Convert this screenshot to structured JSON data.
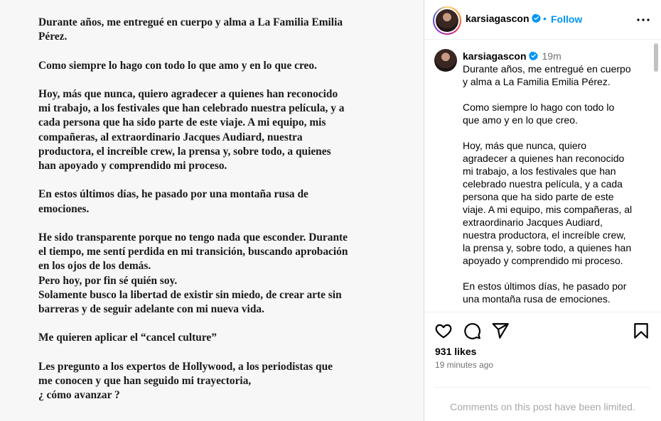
{
  "image_text": {
    "paragraphs": [
      "Durante años, me entregué en cuerpo y alma a La Familia Emilia\nPérez.",
      "Como siempre lo hago con todo lo que amo y en lo que creo.",
      "Hoy, más que nunca, quiero agradecer a quienes han reconocido\nmi trabajo, a los festivales que han celebrado nuestra película, y a\ncada persona que ha sido parte de este viaje. A mi equipo, mis\ncompañeras, al extraordinario Jacques Audiard, nuestra\nproductora, el increíble crew, la prensa y, sobre todo, a quienes\nhan apoyado y comprendido mi proceso.",
      "En estos últimos días, he pasado por una montaña rusa de\nemociones.",
      "He sido transparente porque no tengo nada que esconder. Durante\nel tiempo, me sentí perdida en mi transición, buscando aprobación\nen los ojos de los demás.\nPero hoy, por fin sé quién soy.\nSolamente busco la libertad de existir sin miedo, de crear arte sin\nbarreras y de seguir adelante con mi nueva vida.",
      "Me quieren aplicar el “cancel culture”",
      "Les pregunto a los expertos de Hollywood, a los periodistas que\nme conocen y que han seguido mi trayectoria,\n¿ cómo avanzar ?"
    ]
  },
  "header": {
    "username": "karsiagascon",
    "separator": "•",
    "follow_label": "Follow"
  },
  "caption": {
    "username": "karsiagascon",
    "time": "19m",
    "paragraphs": [
      "Durante años, me entregué en cuerpo\ny alma a La Familia Emilia Pérez.",
      "Como siempre lo hago con todo lo\nque amo y en lo que creo.",
      "Hoy, más que nunca, quiero\nagradecer a quienes han reconocido\nmi trabajo, a los festivales que han\ncelebrado nuestra película, y a cada\npersona que ha sido parte de este\nviaje. A mi equipo, mis compañeras, al\nextraordinario Jacques Audiard,\nnuestra productora, el increíble crew,\nla prensa y, sobre todo, a quienes han\napoyado y comprendido mi proceso.",
      "En estos últimos días, he pasado por\nuna montaña rusa de emociones."
    ]
  },
  "stats": {
    "likes": "931 likes",
    "time_ago": "19 minutes ago"
  },
  "comments_notice": "Comments on this post have been limited.",
  "icons": {
    "verified": "verified-badge-icon",
    "more": "more-options-icon",
    "like": "heart-icon",
    "comment": "comment-icon",
    "share": "send-icon",
    "save": "bookmark-icon"
  },
  "colors": {
    "accent": "#0095f6",
    "secondary_text": "#737373",
    "muted_text": "#a8a8a8"
  }
}
